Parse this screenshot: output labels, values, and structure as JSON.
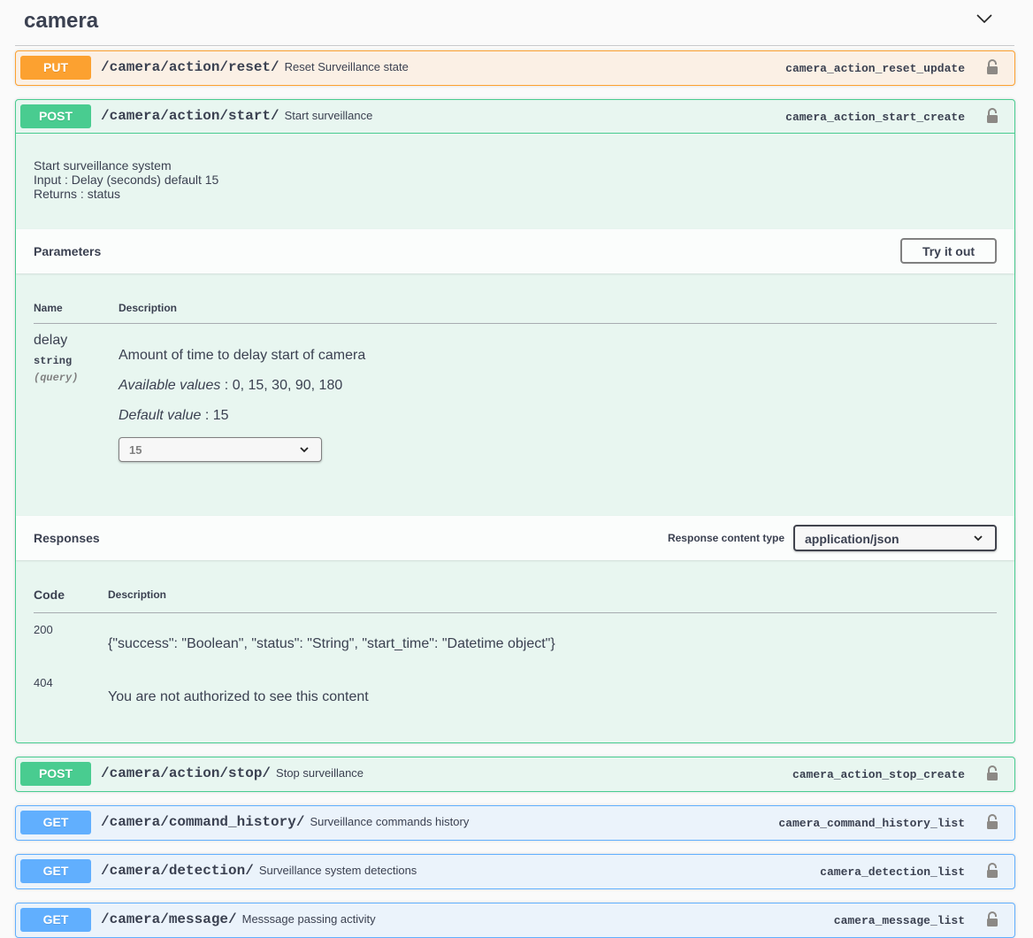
{
  "tag": {
    "title": "camera"
  },
  "operations": [
    {
      "method": "PUT",
      "path": "/camera/action/reset/",
      "summary": "Reset Surveillance state",
      "operation_id": "camera_action_reset_update"
    },
    {
      "method": "POST",
      "path": "/camera/action/start/",
      "summary": "Start surveillance",
      "operation_id": "camera_action_start_create",
      "expanded": true,
      "description_lines": [
        "Start surveillance system",
        "Input : Delay (seconds) default 15",
        "Returns : status"
      ],
      "parameters": {
        "title": "Parameters",
        "try_it_out_label": "Try it out",
        "columns": [
          "Name",
          "Description"
        ],
        "items": [
          {
            "name": "delay",
            "type": "string",
            "in": "(query)",
            "description": "Amount of time to delay start of camera",
            "available_label": "Available values",
            "available_values": ": 0, 15, 30, 90, 180",
            "default_label": "Default value",
            "default_value": ": 15",
            "selected": "15"
          }
        ]
      },
      "responses": {
        "title": "Responses",
        "content_type_label": "Response content type",
        "content_type": "application/json",
        "columns": [
          "Code",
          "Description"
        ],
        "items": [
          {
            "code": "200",
            "description": "{\"success\": \"Boolean\", \"status\": \"String\", \"start_time\": \"Datetime object\"}"
          },
          {
            "code": "404",
            "description": "You are not authorized to see this content"
          }
        ]
      }
    },
    {
      "method": "POST",
      "path": "/camera/action/stop/",
      "summary": "Stop surveillance",
      "operation_id": "camera_action_stop_create"
    },
    {
      "method": "GET",
      "path": "/camera/command_history/",
      "summary": "Surveillance commands history",
      "operation_id": "camera_command_history_list"
    },
    {
      "method": "GET",
      "path": "/camera/detection/",
      "summary": "Surveillance system detections",
      "operation_id": "camera_detection_list"
    },
    {
      "method": "GET",
      "path": "/camera/message/",
      "summary": "Messsage passing activity",
      "operation_id": "camera_message_list"
    }
  ],
  "colors": {
    "put": "#fca130",
    "post": "#49cc90",
    "get": "#61affe",
    "text": "#3b4151"
  }
}
